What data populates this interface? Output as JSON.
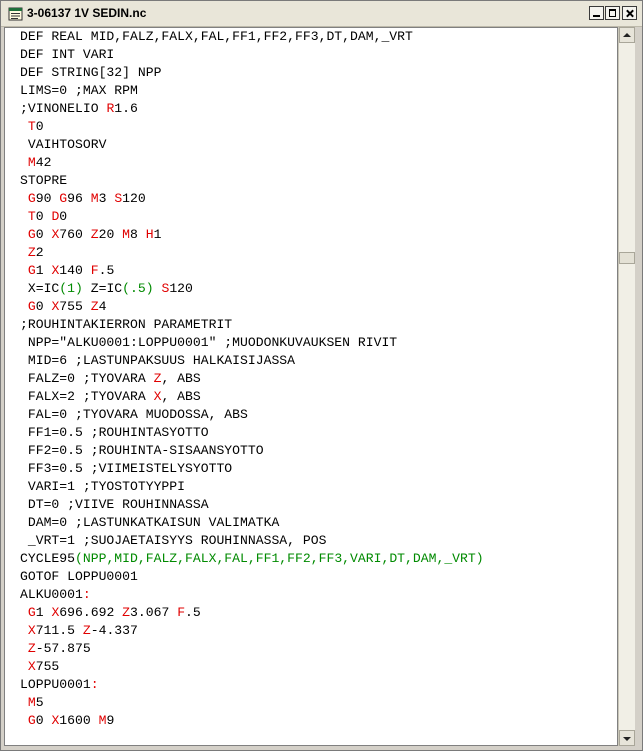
{
  "window": {
    "title": "3-06137 1V SEDIN.nc",
    "app_icon": "notepad-icon",
    "controls": [
      "minimize-icon",
      "maximize-icon",
      "close-icon"
    ]
  },
  "colors": {
    "keyword": "#e00000",
    "parameter": "#008a00",
    "text": "#000000"
  },
  "scroll": {
    "position_fraction": 0.31
  },
  "code_lines": [
    [
      {
        "t": "DEF REAL MID,FALZ,FALX,FAL,FF1,FF2,FF3,DT,DAM,_VRT",
        "c": ""
      }
    ],
    [
      {
        "t": "DEF INT VARI",
        "c": ""
      }
    ],
    [
      {
        "t": "DEF STRING[32] NPP",
        "c": ""
      }
    ],
    [
      {
        "t": "LIMS=0 ;MAX RPM",
        "c": ""
      }
    ],
    [
      {
        "t": ";VINONELIO ",
        "c": ""
      },
      {
        "t": "R",
        "c": "r"
      },
      {
        "t": "1.6",
        "c": ""
      }
    ],
    [
      {
        "t": " ",
        "c": ""
      },
      {
        "t": "T",
        "c": "r"
      },
      {
        "t": "0",
        "c": ""
      }
    ],
    [
      {
        "t": " VAIHTOSORV",
        "c": ""
      }
    ],
    [
      {
        "t": " ",
        "c": ""
      },
      {
        "t": "M",
        "c": "r"
      },
      {
        "t": "42",
        "c": ""
      }
    ],
    [
      {
        "t": "STOPRE",
        "c": ""
      }
    ],
    [
      {
        "t": " ",
        "c": ""
      },
      {
        "t": "G",
        "c": "r"
      },
      {
        "t": "90 ",
        "c": ""
      },
      {
        "t": "G",
        "c": "r"
      },
      {
        "t": "96 ",
        "c": ""
      },
      {
        "t": "M",
        "c": "r"
      },
      {
        "t": "3 ",
        "c": ""
      },
      {
        "t": "S",
        "c": "r"
      },
      {
        "t": "120",
        "c": ""
      }
    ],
    [
      {
        "t": " ",
        "c": ""
      },
      {
        "t": "T",
        "c": "r"
      },
      {
        "t": "0 ",
        "c": ""
      },
      {
        "t": "D",
        "c": "r"
      },
      {
        "t": "0",
        "c": ""
      }
    ],
    [
      {
        "t": " ",
        "c": ""
      },
      {
        "t": "G",
        "c": "r"
      },
      {
        "t": "0 ",
        "c": ""
      },
      {
        "t": "X",
        "c": "r"
      },
      {
        "t": "760 ",
        "c": ""
      },
      {
        "t": "Z",
        "c": "r"
      },
      {
        "t": "20 ",
        "c": ""
      },
      {
        "t": "M",
        "c": "r"
      },
      {
        "t": "8 ",
        "c": ""
      },
      {
        "t": "H",
        "c": "r"
      },
      {
        "t": "1",
        "c": ""
      }
    ],
    [
      {
        "t": " ",
        "c": ""
      },
      {
        "t": "Z",
        "c": "r"
      },
      {
        "t": "2",
        "c": ""
      }
    ],
    [
      {
        "t": " ",
        "c": ""
      },
      {
        "t": "G",
        "c": "r"
      },
      {
        "t": "1 ",
        "c": ""
      },
      {
        "t": "X",
        "c": "r"
      },
      {
        "t": "140 ",
        "c": ""
      },
      {
        "t": "F",
        "c": "r"
      },
      {
        "t": ".5",
        "c": ""
      }
    ],
    [
      {
        "t": " X=IC",
        "c": ""
      },
      {
        "t": "(1)",
        "c": "g"
      },
      {
        "t": " Z=IC",
        "c": ""
      },
      {
        "t": "(.5)",
        "c": "g"
      },
      {
        "t": " ",
        "c": ""
      },
      {
        "t": "S",
        "c": "r"
      },
      {
        "t": "120",
        "c": ""
      }
    ],
    [
      {
        "t": " ",
        "c": ""
      },
      {
        "t": "G",
        "c": "r"
      },
      {
        "t": "0 ",
        "c": ""
      },
      {
        "t": "X",
        "c": "r"
      },
      {
        "t": "755 ",
        "c": ""
      },
      {
        "t": "Z",
        "c": "r"
      },
      {
        "t": "4",
        "c": ""
      }
    ],
    [
      {
        "t": ";ROUHINTAKIERRON PARAMETRIT",
        "c": ""
      }
    ],
    [
      {
        "t": " NPP=\"ALKU0001:LOPPU0001\" ;MUODONKUVAUKSEN RIVIT",
        "c": ""
      }
    ],
    [
      {
        "t": " MID=6 ;LASTUNPAKSUUS HALKAISIJASSA",
        "c": ""
      }
    ],
    [
      {
        "t": " FALZ=0 ;TYOVARA ",
        "c": ""
      },
      {
        "t": "Z",
        "c": "r"
      },
      {
        "t": ", ABS",
        "c": ""
      }
    ],
    [
      {
        "t": " FALX=2 ;TYOVARA ",
        "c": ""
      },
      {
        "t": "X",
        "c": "r"
      },
      {
        "t": ", ABS",
        "c": ""
      }
    ],
    [
      {
        "t": " FAL=0 ;TYOVARA MUODOSSA, ABS",
        "c": ""
      }
    ],
    [
      {
        "t": " FF1=0.5 ;ROUHINTASYOTTO",
        "c": ""
      }
    ],
    [
      {
        "t": " FF2=0.5 ;ROUHINTA-SISAANSYOTTO",
        "c": ""
      }
    ],
    [
      {
        "t": " FF3=0.5 ;VIIMEISTELYSYOTTO",
        "c": ""
      }
    ],
    [
      {
        "t": " VARI=1 ;TYOSTOTYYPPI",
        "c": ""
      }
    ],
    [
      {
        "t": " DT=0 ;VIIVE ROUHINNASSA",
        "c": ""
      }
    ],
    [
      {
        "t": " DAM=0 ;LASTUNKATKAISUN VALIMATKA",
        "c": ""
      }
    ],
    [
      {
        "t": " _VRT=1 ;SUOJAETAISYYS ROUHINNASSA, POS",
        "c": ""
      }
    ],
    [
      {
        "t": "CYCLE95",
        "c": ""
      },
      {
        "t": "(NPP,MID,FALZ,FALX,FAL,FF1,FF2,FF3,VARI,DT,DAM,_VRT)",
        "c": "g"
      }
    ],
    [
      {
        "t": "GOTOF LOPPU0001",
        "c": ""
      }
    ],
    [
      {
        "t": "ALKU0001",
        "c": ""
      },
      {
        "t": ":",
        "c": "r"
      }
    ],
    [
      {
        "t": " ",
        "c": ""
      },
      {
        "t": "G",
        "c": "r"
      },
      {
        "t": "1 ",
        "c": ""
      },
      {
        "t": "X",
        "c": "r"
      },
      {
        "t": "696.692 ",
        "c": ""
      },
      {
        "t": "Z",
        "c": "r"
      },
      {
        "t": "3.067 ",
        "c": ""
      },
      {
        "t": "F",
        "c": "r"
      },
      {
        "t": ".5",
        "c": ""
      }
    ],
    [
      {
        "t": " ",
        "c": ""
      },
      {
        "t": "X",
        "c": "r"
      },
      {
        "t": "711.5 ",
        "c": ""
      },
      {
        "t": "Z",
        "c": "r"
      },
      {
        "t": "-4.337",
        "c": ""
      }
    ],
    [
      {
        "t": " ",
        "c": ""
      },
      {
        "t": "Z",
        "c": "r"
      },
      {
        "t": "-57.875",
        "c": ""
      }
    ],
    [
      {
        "t": " ",
        "c": ""
      },
      {
        "t": "X",
        "c": "r"
      },
      {
        "t": "755",
        "c": ""
      }
    ],
    [
      {
        "t": "LOPPU0001",
        "c": ""
      },
      {
        "t": ":",
        "c": "r"
      }
    ],
    [
      {
        "t": " ",
        "c": ""
      },
      {
        "t": "M",
        "c": "r"
      },
      {
        "t": "5",
        "c": ""
      }
    ],
    [
      {
        "t": " ",
        "c": ""
      },
      {
        "t": "G",
        "c": "r"
      },
      {
        "t": "0 ",
        "c": ""
      },
      {
        "t": "X",
        "c": "r"
      },
      {
        "t": "1600 ",
        "c": ""
      },
      {
        "t": "M",
        "c": "r"
      },
      {
        "t": "9",
        "c": ""
      }
    ]
  ]
}
